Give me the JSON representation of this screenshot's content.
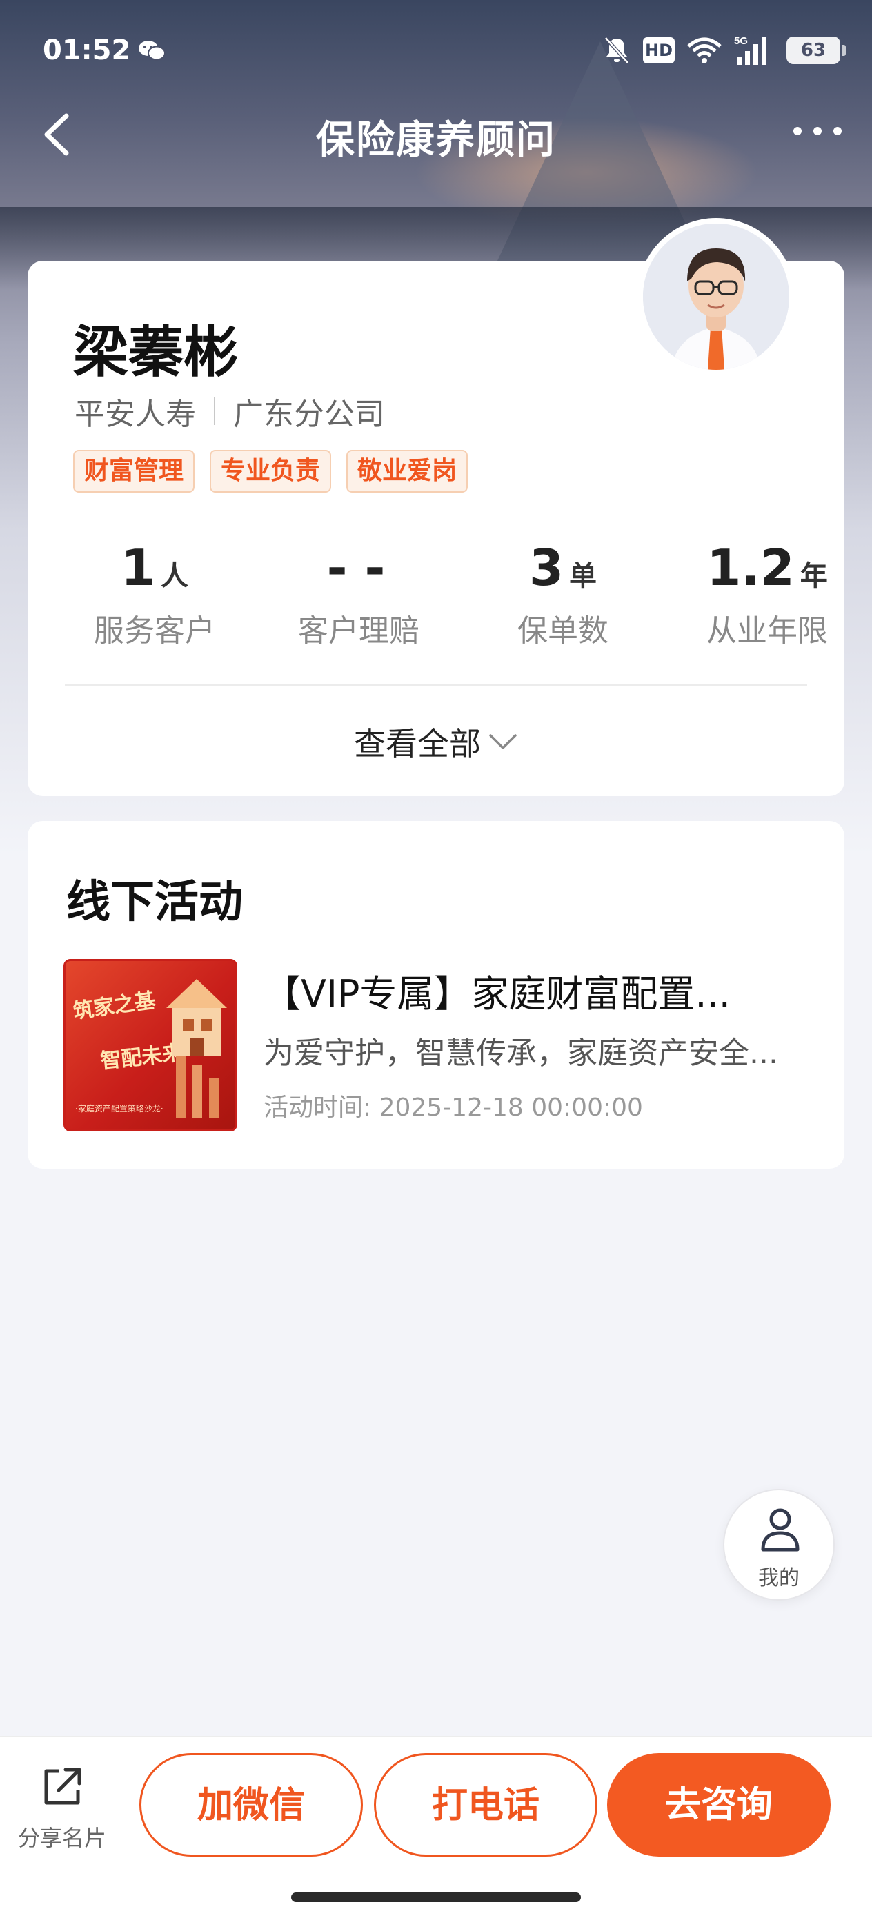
{
  "status_bar": {
    "time": "01:52",
    "battery": "63",
    "hd_label": "HD",
    "network": "5G",
    "icons": [
      "wechat-icon",
      "bell-muted-icon",
      "hd-icon",
      "wifi-icon",
      "signal-icon",
      "battery-icon"
    ]
  },
  "nav": {
    "title": "保险康养顾问",
    "back_icon": "chevron-left-icon",
    "more_icon": "more-horizontal-icon"
  },
  "profile": {
    "name": "梁蓁彬",
    "company": "平安人寿",
    "branch": "广东分公司",
    "tags": [
      "财富管理",
      "专业负责",
      "敬业爱岗"
    ],
    "stats": [
      {
        "value": "1",
        "unit": "人",
        "label": "服务客户"
      },
      {
        "value": "- -",
        "unit": "",
        "label": "客户理赔"
      },
      {
        "value": "3",
        "unit": "单",
        "label": "保单数"
      },
      {
        "value": "1.2",
        "unit": "年",
        "label": "从业年限"
      }
    ],
    "view_all": "查看全部"
  },
  "activities": {
    "heading": "线下活动",
    "items": [
      {
        "title": "【VIP专属】家庭财富配置...",
        "description": "为爱守护，智慧传承，家庭资产安全...",
        "time": "活动时间: 2025-12-18 00:00:00",
        "thumb_line1": "筑家之基",
        "thumb_line2": "智配未来",
        "thumb_line3": "·家庭资产配置策略沙龙·"
      }
    ]
  },
  "floating": {
    "mine_label": "我的"
  },
  "bottom_bar": {
    "share_label": "分享名片",
    "wechat_button": "加微信",
    "call_button": "打电话",
    "consult_button": "去咨询"
  },
  "colors": {
    "accent": "#f35a22",
    "tag_bg": "#fdf1e8",
    "tag_text": "#f0561f",
    "page_bg": "#f3f4f9"
  }
}
